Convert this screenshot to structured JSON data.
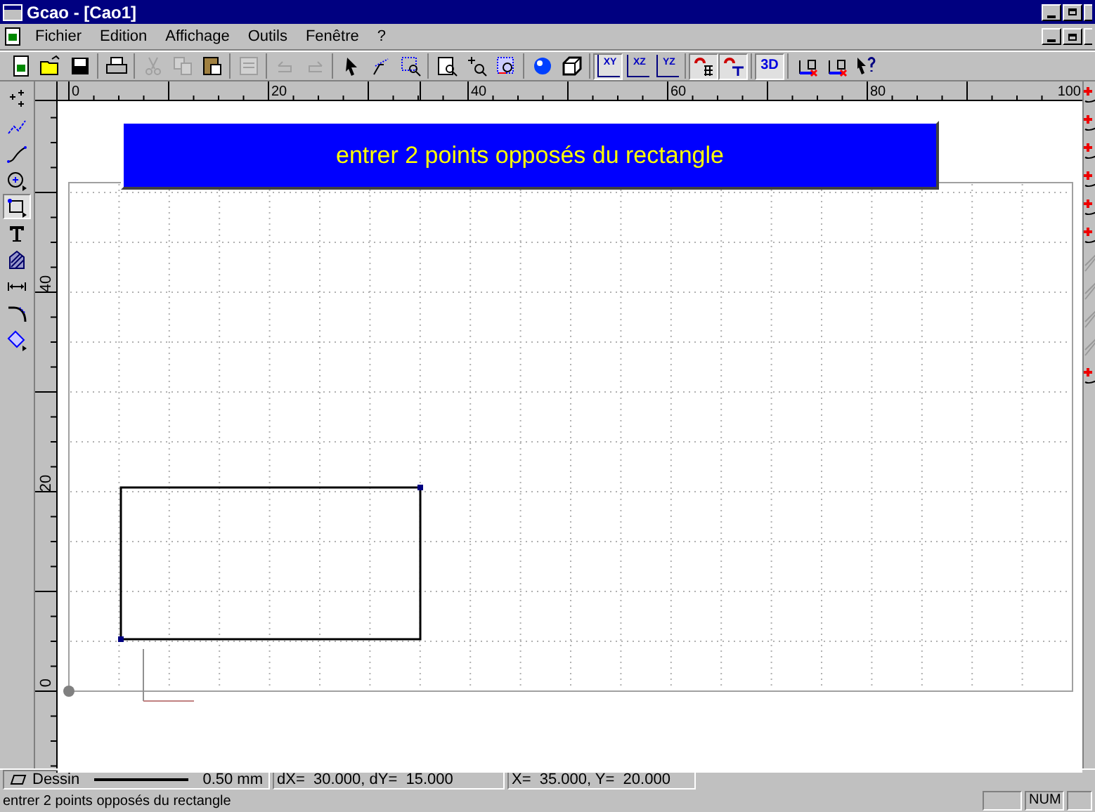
{
  "window": {
    "title": "Gcao - [Cao1]"
  },
  "menu": [
    {
      "label": "Fichier"
    },
    {
      "label": "Edition"
    },
    {
      "label": "Affichage"
    },
    {
      "label": "Outils"
    },
    {
      "label": "Fenêtre"
    },
    {
      "label": "?"
    }
  ],
  "toolbar": [
    [
      {
        "kind": "new",
        "pressed": false,
        "disabled": false
      },
      {
        "kind": "open",
        "pressed": false,
        "disabled": false
      },
      {
        "kind": "save",
        "pressed": false,
        "disabled": false
      }
    ],
    [
      {
        "kind": "print",
        "pressed": false,
        "disabled": false
      }
    ],
    [
      {
        "kind": "cut",
        "pressed": false,
        "disabled": true
      },
      {
        "kind": "copy",
        "pressed": false,
        "disabled": true
      },
      {
        "kind": "paste",
        "pressed": false,
        "disabled": false
      }
    ],
    [
      {
        "kind": "properties",
        "pressed": false,
        "disabled": true
      }
    ],
    [
      {
        "kind": "undo",
        "pressed": false,
        "disabled": true
      },
      {
        "kind": "redo",
        "pressed": false,
        "disabled": true
      }
    ],
    [
      {
        "kind": "pointer",
        "pressed": false,
        "disabled": false
      },
      {
        "kind": "arc-pointer",
        "pressed": false,
        "disabled": false
      },
      {
        "kind": "zoom-window",
        "pressed": false,
        "disabled": false
      }
    ],
    [
      {
        "kind": "zoom-page",
        "pressed": false,
        "disabled": false
      },
      {
        "kind": "zoom-in",
        "pressed": false,
        "disabled": false
      },
      {
        "kind": "zoom-all",
        "pressed": false,
        "disabled": false
      }
    ],
    [
      {
        "kind": "sphere",
        "pressed": false,
        "disabled": false
      },
      {
        "kind": "cube",
        "pressed": false,
        "disabled": false
      }
    ],
    [
      {
        "kind": "plane",
        "label": "XY",
        "pressed": true,
        "disabled": false
      },
      {
        "kind": "plane",
        "label": "XZ",
        "pressed": false,
        "disabled": false
      },
      {
        "kind": "plane",
        "label": "YZ",
        "pressed": false,
        "disabled": false
      }
    ],
    [
      {
        "kind": "magnet-grid",
        "pressed": true,
        "disabled": false
      },
      {
        "kind": "magnet-ortho",
        "pressed": true,
        "disabled": false
      }
    ],
    [
      {
        "kind": "text",
        "label": "3D",
        "pressed": true,
        "disabled": false
      }
    ],
    [
      {
        "kind": "layer",
        "pressed": false,
        "disabled": false
      },
      {
        "kind": "layer",
        "pressed": false,
        "disabled": false
      },
      {
        "kind": "help",
        "pressed": false,
        "disabled": false
      }
    ]
  ],
  "left_tools": [
    {
      "kind": "points",
      "selected": false
    },
    {
      "kind": "polyline",
      "selected": false
    },
    {
      "kind": "curve",
      "selected": false
    },
    {
      "kind": "circle",
      "selected": false
    },
    {
      "kind": "rectangle",
      "selected": true
    },
    {
      "kind": "text",
      "selected": false
    },
    {
      "kind": "hatch",
      "selected": false
    },
    {
      "kind": "dimension",
      "selected": false
    },
    {
      "kind": "fillet",
      "selected": false
    },
    {
      "kind": "fill",
      "selected": false
    }
  ],
  "right_tools": [
    {
      "kind": "snap"
    },
    {
      "kind": "snap"
    },
    {
      "kind": "snap"
    },
    {
      "kind": "snap"
    },
    {
      "kind": "snap"
    },
    {
      "kind": "snap"
    },
    {
      "kind": "line"
    },
    {
      "kind": "line"
    },
    {
      "kind": "line"
    },
    {
      "kind": "line"
    },
    {
      "kind": "snap"
    }
  ],
  "rulers": {
    "top_labels": [
      "0",
      "20",
      "40",
      "60",
      "80",
      "100"
    ],
    "left_labels": [
      "40",
      "20",
      "0"
    ]
  },
  "prompt": "entrer 2 points opposés du rectangle",
  "status_bar": {
    "mode": "Dessin",
    "line_width": "0.50 mm",
    "delta": "dX=  30.000, dY=  15.000",
    "position": "X=  35.000, Y=  20.000",
    "message": "entrer 2 points opposés du rectangle",
    "indicators": [
      {
        "kind": "blank"
      },
      {
        "kind": "text",
        "label": "NUM"
      },
      {
        "kind": "blank"
      }
    ]
  }
}
